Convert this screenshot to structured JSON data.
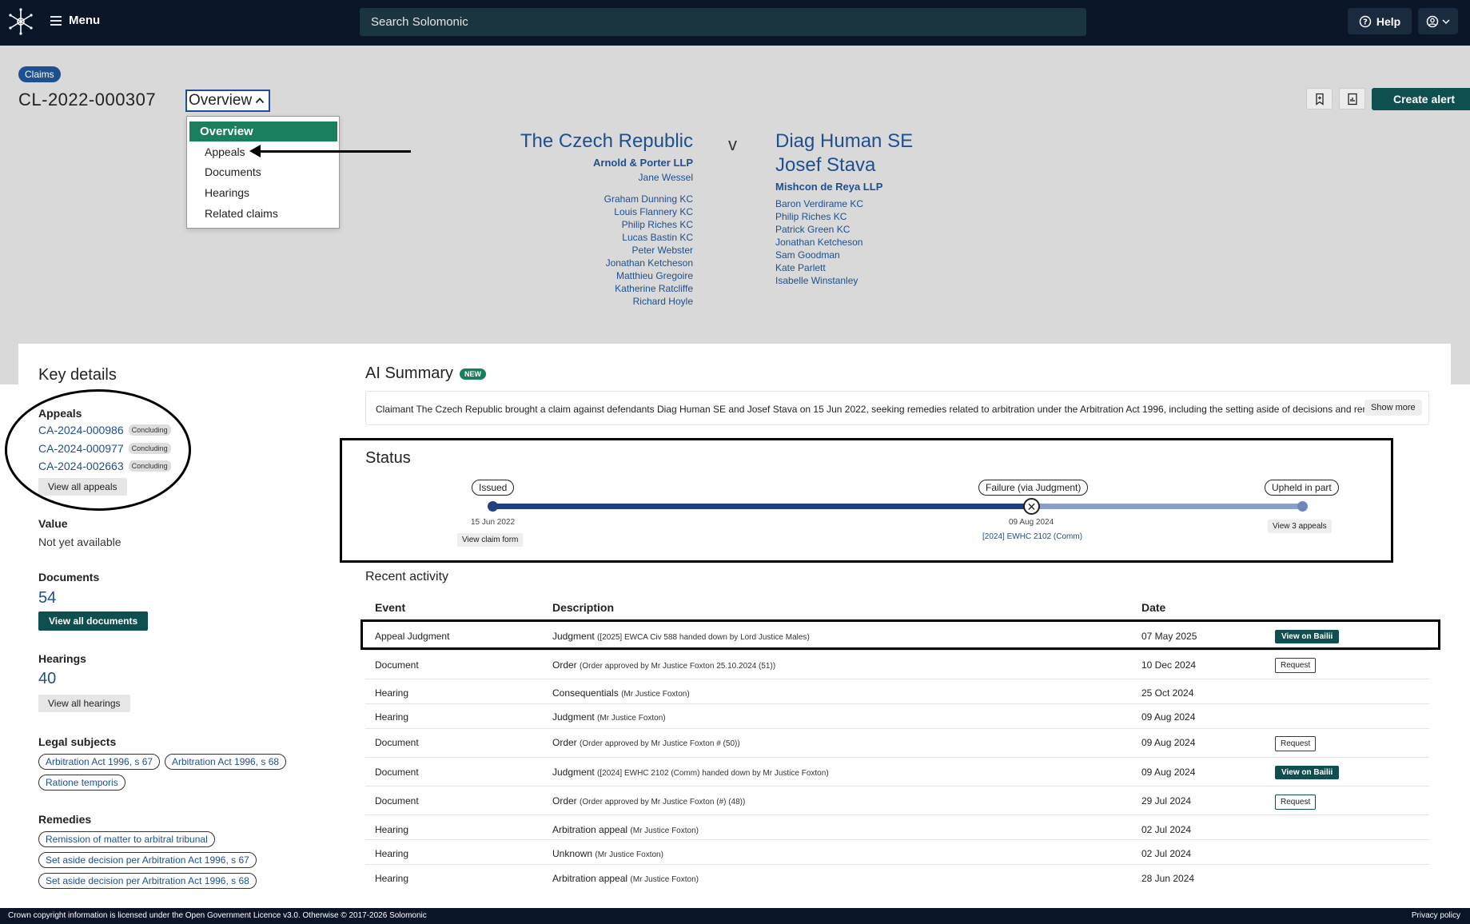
{
  "nav": {
    "menu_label": "Menu",
    "search_placeholder": "Search Solomonic",
    "help_label": "Help"
  },
  "header": {
    "badge": "Claims",
    "claim_id": "CL-2022-000307",
    "view_selected": "Overview",
    "view_options": [
      "Overview",
      "Appeals",
      "Documents",
      "Hearings",
      "Related claims"
    ],
    "create_alert": "Create alert"
  },
  "parties": {
    "claimant": {
      "name": "The Czech Republic",
      "firm": "Arnold & Porter LLP",
      "solicitor": "Jane Wessel",
      "counsel": [
        "Graham Dunning KC",
        "Louis Flannery KC",
        "Philip Riches KC",
        "Lucas Bastin KC",
        "Peter Webster",
        "Jonathan Ketcheson",
        "Matthieu Gregoire",
        "Katherine Ratcliffe",
        "Richard Hoyle"
      ]
    },
    "vs": "v",
    "defendant": {
      "names": [
        "Diag Human SE",
        "Josef Stava"
      ],
      "firm": "Mishcon de Reya LLP",
      "counsel": [
        "Baron Verdirame KC",
        "Philip Riches KC",
        "Patrick Green KC",
        "Jonathan Ketcheson",
        "Sam Goodman",
        "Kate Parlett",
        "Isabelle Winstanley"
      ]
    }
  },
  "key_details": {
    "title": "Key details",
    "appeals_label": "Appeals",
    "appeals": [
      {
        "id": "CA-2024-000986",
        "status": "Concluding"
      },
      {
        "id": "CA-2024-000977",
        "status": "Concluding"
      },
      {
        "id": "CA-2024-002663",
        "status": "Concluding"
      }
    ],
    "view_all_appeals": "View all appeals",
    "value_label": "Value",
    "value": "Not yet available",
    "documents_label": "Documents",
    "documents_count": "54",
    "view_all_documents": "View all documents",
    "hearings_label": "Hearings",
    "hearings_count": "40",
    "view_all_hearings": "View all hearings",
    "legal_subjects_label": "Legal subjects",
    "legal_subjects": [
      "Arbitration Act 1996, s 67",
      "Arbitration Act 1996, s 68",
      "Ratione temporis"
    ],
    "remedies_label": "Remedies",
    "remedies": [
      "Remission of matter to arbitral tribunal",
      "Set aside decision per Arbitration Act 1996, s 67",
      "Set aside decision per Arbitration Act 1996, s 68"
    ]
  },
  "ai_summary": {
    "title": "AI Summary",
    "badge": "NEW",
    "text": "Claimant The Czech Republic brought a claim against defendants Diag Human SE and Josef Stava on 15 Jun 2022, seeking remedies related to arbitration under the Arbitration Act 1996, including the setting aside of decisions and remis...",
    "show_more": "Show more"
  },
  "status": {
    "title": "Status",
    "stages": [
      {
        "label": "Issued",
        "date": "15 Jun 2022",
        "action": "View claim form"
      },
      {
        "label": "Failure (via Judgment)",
        "date": "09 Aug 2024",
        "link": "[2024] EWHC 2102 (Comm)"
      },
      {
        "label": "Upheld in part",
        "action": "View 3 appeals"
      }
    ],
    "colors": {
      "done": "#1f3f80",
      "pending": "#8aa0c8"
    }
  },
  "recent_activity": {
    "title": "Recent activity",
    "columns": [
      "Event",
      "Description",
      "Date"
    ],
    "rows": [
      {
        "event": "Appeal Judgment",
        "main": "Judgment",
        "pre": "(",
        "link1": "[2025] EWCA Civ 588",
        "mid": " handed down by ",
        "link2": "Lord Justice Males",
        "post": ")",
        "date": "07 May 2025",
        "action": "View on Bailii"
      },
      {
        "event": "Document",
        "main": "Order",
        "detail": "(Order approved by Mr Justice Foxton 25.10.2024 (51))",
        "date": "10 Dec 2024",
        "action": "Request"
      },
      {
        "event": "Hearing",
        "main": "Consequentials",
        "detail": "(Mr Justice Foxton)",
        "date": "25 Oct 2024",
        "action": ""
      },
      {
        "event": "Hearing",
        "main": "Judgment",
        "detail": "(Mr Justice Foxton)",
        "date": "09 Aug 2024",
        "action": ""
      },
      {
        "event": "Document",
        "main": "Order",
        "detail": "(Order approved by Mr Justice Foxton # (50))",
        "date": "09 Aug 2024",
        "action": "Request"
      },
      {
        "event": "Document",
        "main": "Judgment",
        "pre": "(",
        "link1": "[2024] EWHC 2102 (Comm)",
        "mid": " handed down by ",
        "link2": "Mr Justice Foxton",
        "post": ")",
        "date": "09 Aug 2024",
        "action": "View on Bailii"
      },
      {
        "event": "Document",
        "main": "Order",
        "detail": "(Order approved by Mr Justice Foxton (#) (48))",
        "date": "29 Jul 2024",
        "action": "Request"
      },
      {
        "event": "Hearing",
        "main": "Arbitration appeal",
        "detail": "(Mr Justice Foxton)",
        "date": "02 Jul 2024",
        "action": ""
      },
      {
        "event": "Hearing",
        "main": "Unknown",
        "detail": "(Mr Justice Foxton)",
        "date": "02 Jul 2024",
        "action": ""
      },
      {
        "event": "Hearing",
        "main": "Arbitration appeal",
        "detail": "(Mr Justice Foxton)",
        "date": "28 Jun 2024",
        "action": ""
      }
    ]
  },
  "footer": {
    "copyright": "Crown copyright information is licensed under the Open Government Licence v3.0. Otherwise © 2017-2026 Solomonic",
    "privacy": "Privacy policy"
  }
}
